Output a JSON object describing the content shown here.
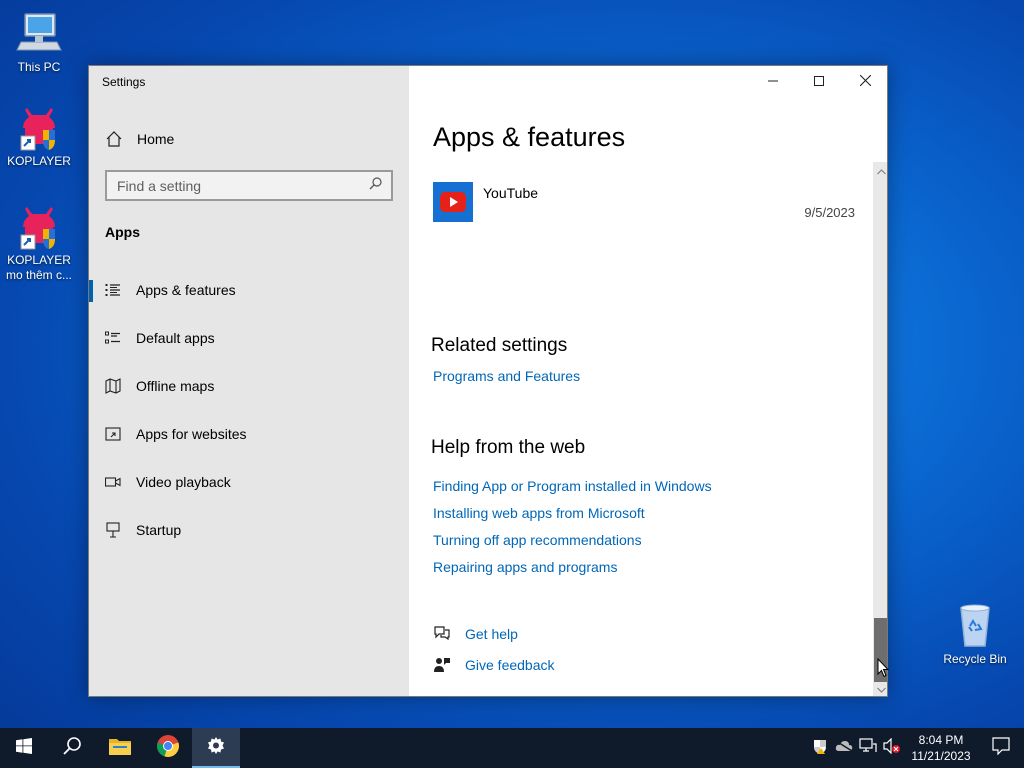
{
  "desktop": {
    "icons": [
      {
        "label": "This PC"
      },
      {
        "label": "KOPLAYER"
      },
      {
        "label": "KOPLAYER mo thêm c..."
      },
      {
        "label": "Recycle Bin"
      }
    ]
  },
  "window": {
    "title": "Settings",
    "caption": {
      "minimize": "minimize-icon",
      "maximize": "maximize-icon",
      "close": "close-icon"
    }
  },
  "sidebar": {
    "home_label": "Home",
    "search_placeholder": "Find a setting",
    "section_title": "Apps",
    "items": [
      {
        "label": "Apps & features",
        "icon": "apps-features-icon",
        "active": true
      },
      {
        "label": "Default apps",
        "icon": "default-apps-icon",
        "active": false
      },
      {
        "label": "Offline maps",
        "icon": "offline-maps-icon",
        "active": false
      },
      {
        "label": "Apps for websites",
        "icon": "apps-websites-icon",
        "active": false
      },
      {
        "label": "Video playback",
        "icon": "video-playback-icon",
        "active": false
      },
      {
        "label": "Startup",
        "icon": "startup-icon",
        "active": false
      }
    ]
  },
  "main": {
    "title": "Apps & features",
    "apps": [
      {
        "name": "YouTube",
        "date": "9/5/2023",
        "icon": "youtube-icon"
      }
    ],
    "related": {
      "heading": "Related settings",
      "links": [
        "Programs and Features"
      ]
    },
    "help": {
      "heading": "Help from the web",
      "links": [
        "Finding App or Program installed in Windows",
        "Installing web apps from Microsoft",
        "Turning off app recommendations",
        "Repairing apps and programs"
      ]
    },
    "support": {
      "get_help": "Get help",
      "give_feedback": "Give feedback"
    }
  },
  "taskbar": {
    "time": "8:04 PM",
    "date": "11/21/2023"
  },
  "colors": {
    "accent": "#0063b1",
    "link": "#0067b8",
    "sidebar_bg": "#e6e6e6",
    "taskbar_bg": "#0f1a2b"
  }
}
